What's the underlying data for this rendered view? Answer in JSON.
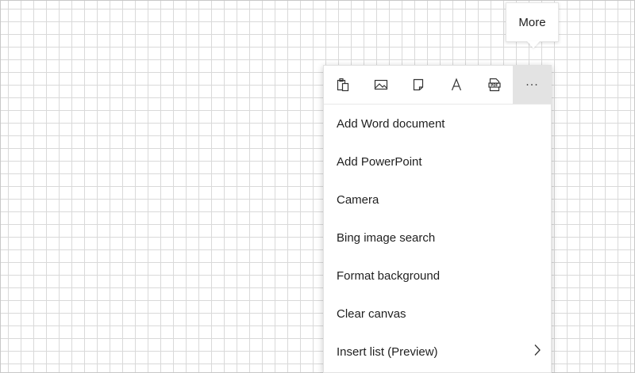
{
  "tooltip": {
    "text": "More"
  },
  "toolbar": {
    "tools": [
      {
        "icon": "clipboard-icon"
      },
      {
        "icon": "image-icon"
      },
      {
        "icon": "sticky-note-icon"
      },
      {
        "icon": "text-icon",
        "glyph": "A"
      },
      {
        "icon": "pdf-icon",
        "glyph": "PDF"
      },
      {
        "icon": "more-icon",
        "glyph": "···"
      }
    ]
  },
  "menu": {
    "items": [
      {
        "label": "Add Word document"
      },
      {
        "label": "Add PowerPoint"
      },
      {
        "label": "Camera"
      },
      {
        "label": "Bing image search"
      },
      {
        "label": "Format background"
      },
      {
        "label": "Clear canvas"
      },
      {
        "label": "Insert list (Preview)",
        "icon": "chevron-right-icon"
      }
    ]
  },
  "colors": {
    "grid_line": "#d9d9d9",
    "active_tool_bg": "#e3e3e3",
    "text": "#1f1f1f"
  }
}
